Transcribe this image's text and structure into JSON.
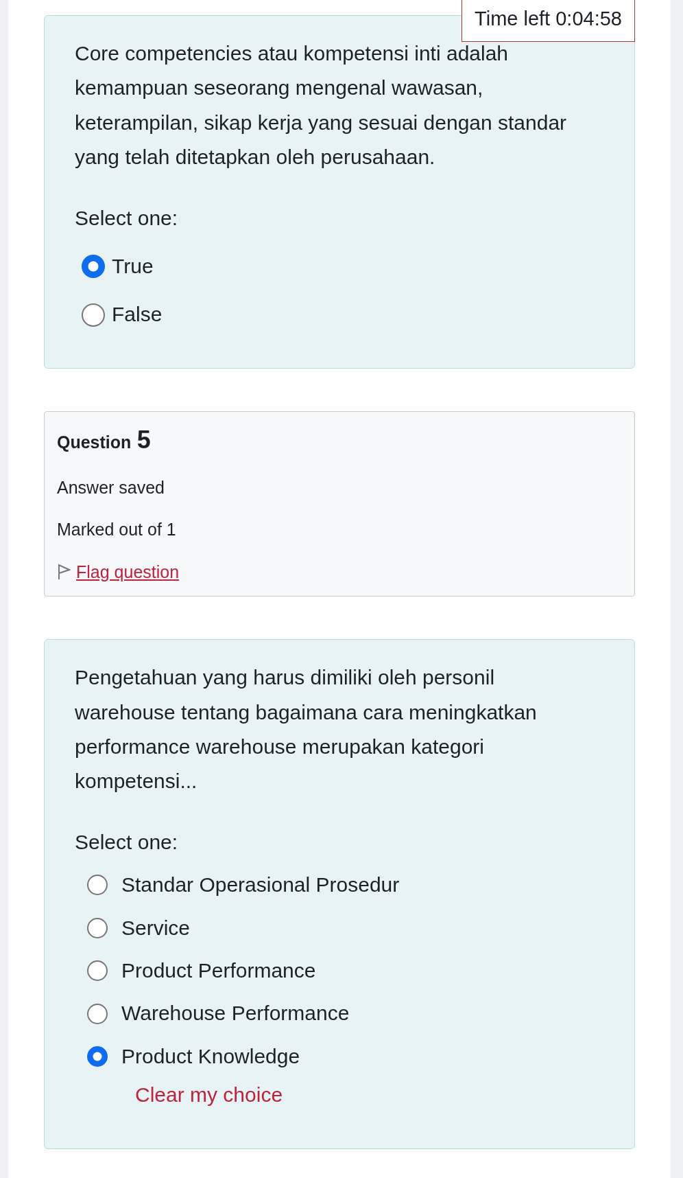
{
  "timer": {
    "label": "Time left",
    "value": "0:04:58"
  },
  "previous_question": {
    "text": "Core competencies atau kompetensi inti adalah kemampuan seseorang mengenal wawasan, keterampilan, sikap kerja yang sesuai dengan standar yang telah ditetapkan oleh perusahaan.",
    "prompt": "Select one:",
    "options": [
      {
        "label": "True",
        "selected": true
      },
      {
        "label": "False",
        "selected": false
      }
    ]
  },
  "question_info": {
    "title": "Question",
    "number": "5",
    "status": "Answer saved",
    "marks": "Marked out of 1",
    "flag": {
      "label": "Flag question",
      "flagged": false
    }
  },
  "question": {
    "text": "Pengetahuan yang harus dimiliki oleh personil warehouse tentang bagaimana cara meningkatkan performance warehouse merupakan kategori kompetensi...",
    "prompt": "Select one:",
    "options": [
      {
        "label": "Standar Operasional Prosedur",
        "selected": false
      },
      {
        "label": "Service",
        "selected": false
      },
      {
        "label": "Product Performance",
        "selected": false
      },
      {
        "label": "Warehouse Performance",
        "selected": false
      },
      {
        "label": "Product Knowledge",
        "selected": true
      }
    ],
    "clear_label": "Clear my choice"
  }
}
